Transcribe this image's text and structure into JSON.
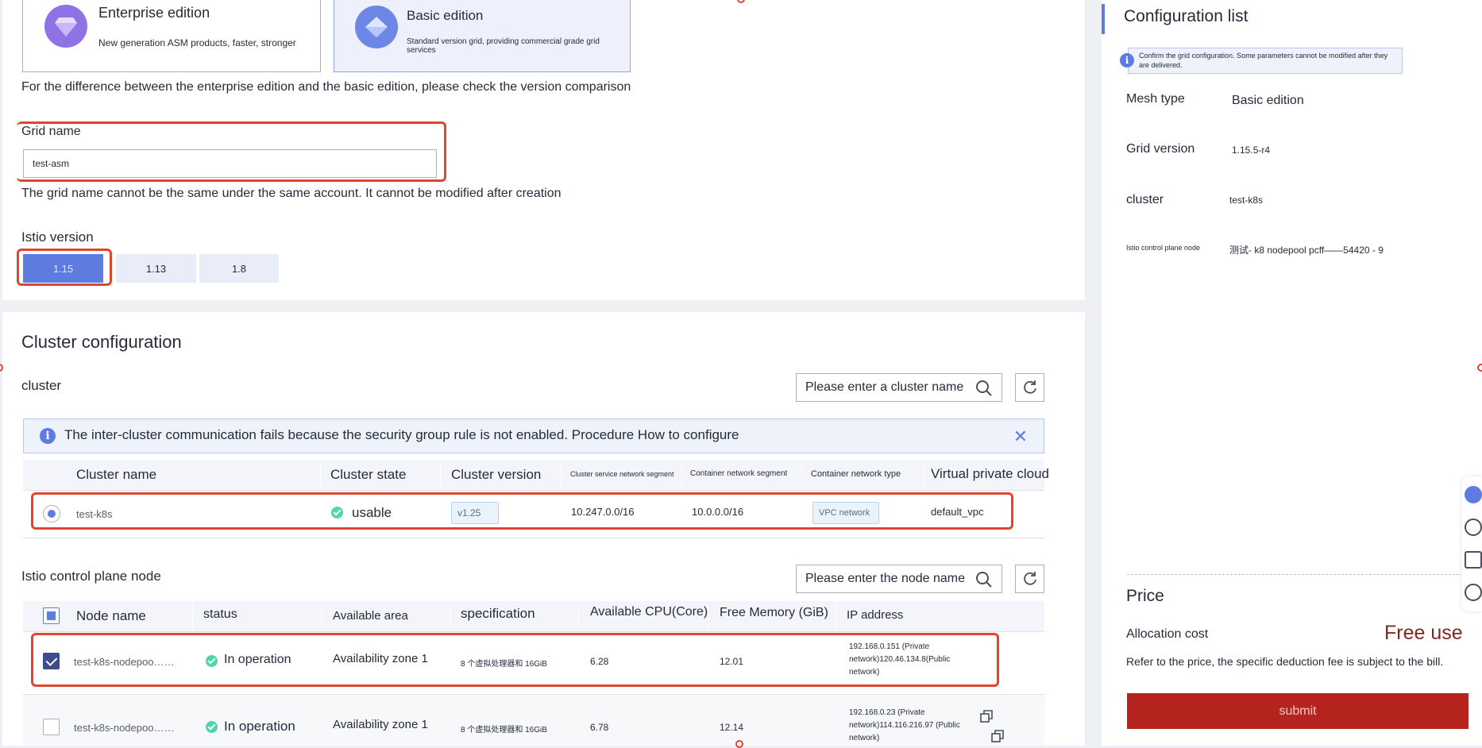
{
  "editions": [
    {
      "title": "Enterprise edition",
      "desc": "New generation ASM products, faster, stronger",
      "selected": false
    },
    {
      "title": "Basic edition",
      "desc": "Standard version grid, providing commercial grade grid services",
      "selected": true
    }
  ],
  "edition_note": "For the difference between the enterprise edition and the basic edition, please check the version comparison",
  "grid_name": {
    "label": "Grid name",
    "value": "test-asm",
    "hint": "The grid name cannot be the same under the same account. It cannot be modified after creation"
  },
  "istio_version": {
    "label": "Istio version",
    "options": [
      "1.15",
      "1.13",
      "1.8"
    ],
    "selected": "1.15"
  },
  "cluster_config": {
    "title": "Cluster configuration",
    "cluster_label": "cluster",
    "search_placeholder": "Please enter a cluster name",
    "alert": "The inter-cluster communication fails because the security group rule is not enabled. Procedure How to configure",
    "columns": [
      "Cluster name",
      "Cluster state",
      "Cluster version",
      "Cluster service network segment",
      "Container network segment",
      "Container network type",
      "Virtual private cloud"
    ],
    "rows": [
      {
        "name": "test-k8s",
        "state": "usable",
        "version": "v1.25",
        "service_segment": "10.247.0.0/16",
        "container_segment": "10.0.0.0/16",
        "network_type": "VPC network",
        "vpc": "default_vpc"
      }
    ]
  },
  "control_plane": {
    "title": "Istio control plane node",
    "search_placeholder": "Please enter the node name",
    "columns": [
      "Node name",
      "status",
      "Available area",
      "specification",
      "Available CPU(Core)",
      "Free Memory (GiB)",
      "IP address"
    ],
    "rows": [
      {
        "name": "test-k8s-nodepoo……",
        "status": "In operation",
        "zone": "Availability zone 1",
        "spec": "8 个虚拟处理器和 16GiB",
        "cpu": "6.28",
        "memory": "12.01",
        "ip_line1": "192.168.0.151 (Private",
        "ip_line2": "network)120.46.134.8(Public",
        "ip_line3": "network)",
        "checked": true
      },
      {
        "name": "test-k8s-nodepoo……",
        "status": "In operation",
        "zone": "Availability zone 1",
        "spec": "8 个虚拟处理器和 16GiB",
        "cpu": "6.78",
        "memory": "12.14",
        "ip_line1": "192.168.0.23 (Private",
        "ip_line2": "network)114.116.216.97 (Public",
        "ip_line3": "network)",
        "checked": false
      }
    ]
  },
  "side": {
    "title": "Configuration list",
    "note_line1": "Confirm the grid configuration. Some parameters cannot be modified after they",
    "note_line2": "are delivered.",
    "items": [
      {
        "key": "Mesh type",
        "value": "Basic edition"
      },
      {
        "key": "Grid version",
        "value": "1.15.5-r4"
      },
      {
        "key": "cluster",
        "value": "test-k8s"
      },
      {
        "key": "Istio control plane node",
        "value": "测试- k8 nodepool pcff——54420 - 9"
      }
    ],
    "price_title": "Price",
    "cost_label": "Allocation cost",
    "cost_value": "Free use",
    "price_note": "Refer to the price, the specific deduction fee is subject to the bill.",
    "submit_label": "submit"
  },
  "colors": {
    "accent": "#5e7ce0",
    "submit": "#b5231e",
    "highlight": "#e0452d",
    "success": "#50d4ab",
    "free": "#7a2a22"
  },
  "icons": [
    "gem-icon",
    "search-icon",
    "refresh-icon",
    "info-icon",
    "close-icon",
    "check-icon",
    "copy-icon",
    "headset-icon",
    "help-icon",
    "edit-icon",
    "smile-icon"
  ]
}
